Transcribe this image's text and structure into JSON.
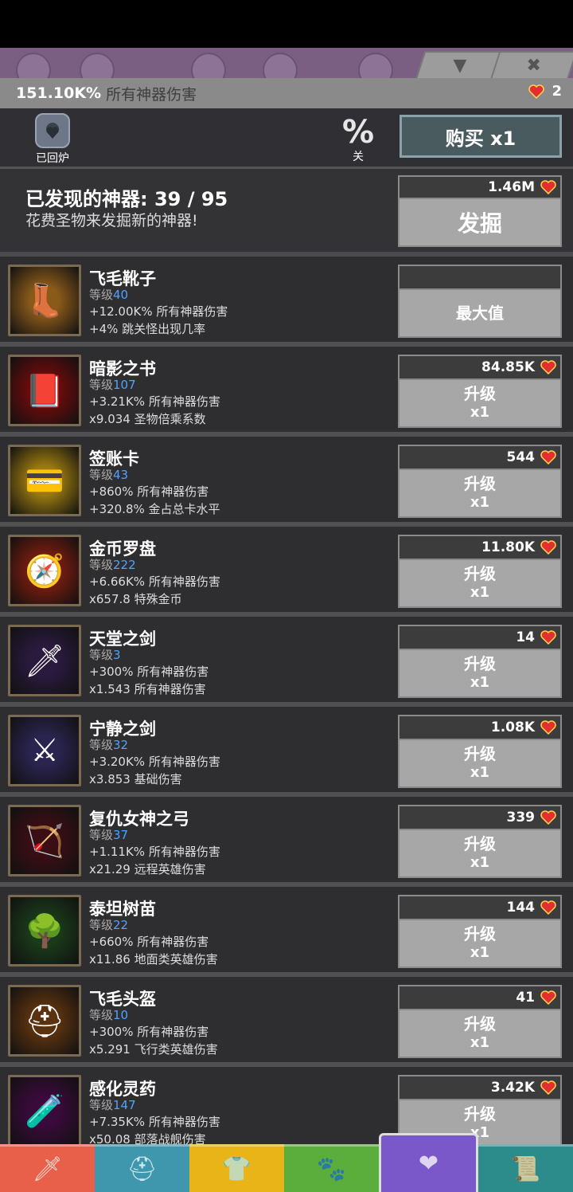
{
  "header": {
    "total_damage": "151.10K%",
    "total_label": "所有神器伤害",
    "currency_count": "2"
  },
  "controls": {
    "salvage_label": "已回炉",
    "percent_symbol": "%",
    "percent_state": "关",
    "buy_label": "购买 x1"
  },
  "discover": {
    "title": "已发现的神器: 39 / 95",
    "subtitle": "花费圣物来发掘新的神器!",
    "cost": "1.46M",
    "button": "发掘"
  },
  "level_prefix": "等级",
  "artifacts": [
    {
      "name": "飞毛靴子",
      "level": "40",
      "effect1": "+12.00K% 所有神器伤害",
      "effect2": "+4% 跳关怪出现几率",
      "cost": "",
      "button": "最大值",
      "mult": "",
      "color": "#8a5a1a",
      "glyph": "👢"
    },
    {
      "name": "暗影之书",
      "level": "107",
      "effect1": "+3.21K% 所有神器伤害",
      "effect2": "x9.034 圣物倍乘系数",
      "cost": "84.85K",
      "button": "升级",
      "mult": "x1",
      "color": "#6d0b0b",
      "glyph": "📕"
    },
    {
      "name": "签账卡",
      "level": "43",
      "effect1": "+860% 所有神器伤害",
      "effect2": "+320.8% 金占总卡水平",
      "cost": "544",
      "button": "升级",
      "mult": "x1",
      "color": "#9a7a10",
      "glyph": "💳"
    },
    {
      "name": "金币罗盘",
      "level": "222",
      "effect1": "+6.66K% 所有神器伤害",
      "effect2": "x657.8 特殊金币",
      "cost": "11.80K",
      "button": "升级",
      "mult": "x1",
      "color": "#7a1c10",
      "glyph": "🧭"
    },
    {
      "name": "天堂之剑",
      "level": "3",
      "effect1": "+300% 所有神器伤害",
      "effect2": "x1.543 所有神器伤害",
      "cost": "14",
      "button": "升级",
      "mult": "x1",
      "color": "#2a1a3e",
      "glyph": "🗡"
    },
    {
      "name": "宁静之剑",
      "level": "32",
      "effect1": "+3.20K% 所有神器伤害",
      "effect2": "x3.853 基础伤害",
      "cost": "1.08K",
      "button": "升级",
      "mult": "x1",
      "color": "#2a2450",
      "glyph": "⚔"
    },
    {
      "name": "复仇女神之弓",
      "level": "37",
      "effect1": "+1.11K% 所有神器伤害",
      "effect2": "x21.29 远程英雄伤害",
      "cost": "339",
      "button": "升级",
      "mult": "x1",
      "color": "#3a0e14",
      "glyph": "🏹"
    },
    {
      "name": "泰坦树苗",
      "level": "22",
      "effect1": "+660% 所有神器伤害",
      "effect2": "x11.86 地面类英雄伤害",
      "cost": "144",
      "button": "升级",
      "mult": "x1",
      "color": "#1a3a1a",
      "glyph": "🌳"
    },
    {
      "name": "飞毛头盔",
      "level": "10",
      "effect1": "+300% 所有神器伤害",
      "effect2": "x5.291 飞行类英雄伤害",
      "cost": "41",
      "button": "升级",
      "mult": "x1",
      "color": "#5a3210",
      "glyph": "⛑"
    },
    {
      "name": "感化灵药",
      "level": "147",
      "effect1": "+7.35K% 所有神器伤害",
      "effect2": "x50.08 部落战舰伤害",
      "cost": "3.42K",
      "button": "升级",
      "mult": "x1",
      "color": "#3a0a3a",
      "glyph": "🧪"
    }
  ],
  "tabs": [
    {
      "name": "tab-sword",
      "color": "#e8604a",
      "icon": "sword-icon",
      "glyph": "🗡"
    },
    {
      "name": "tab-heroes",
      "color": "#3e97ad",
      "icon": "viking-icon",
      "glyph": "⛑"
    },
    {
      "name": "tab-equipment",
      "color": "#e8b418",
      "icon": "shirt-icon",
      "glyph": "👕"
    },
    {
      "name": "tab-pets",
      "color": "#5cae3c",
      "icon": "pet-icon",
      "glyph": "🐾"
    },
    {
      "name": "tab-artifacts",
      "color": "#7b58c9",
      "icon": "winged-heart-icon",
      "glyph": "❤"
    },
    {
      "name": "tab-shop",
      "color": "#2c8c8c",
      "icon": "scroll-icon",
      "glyph": "📜"
    }
  ]
}
